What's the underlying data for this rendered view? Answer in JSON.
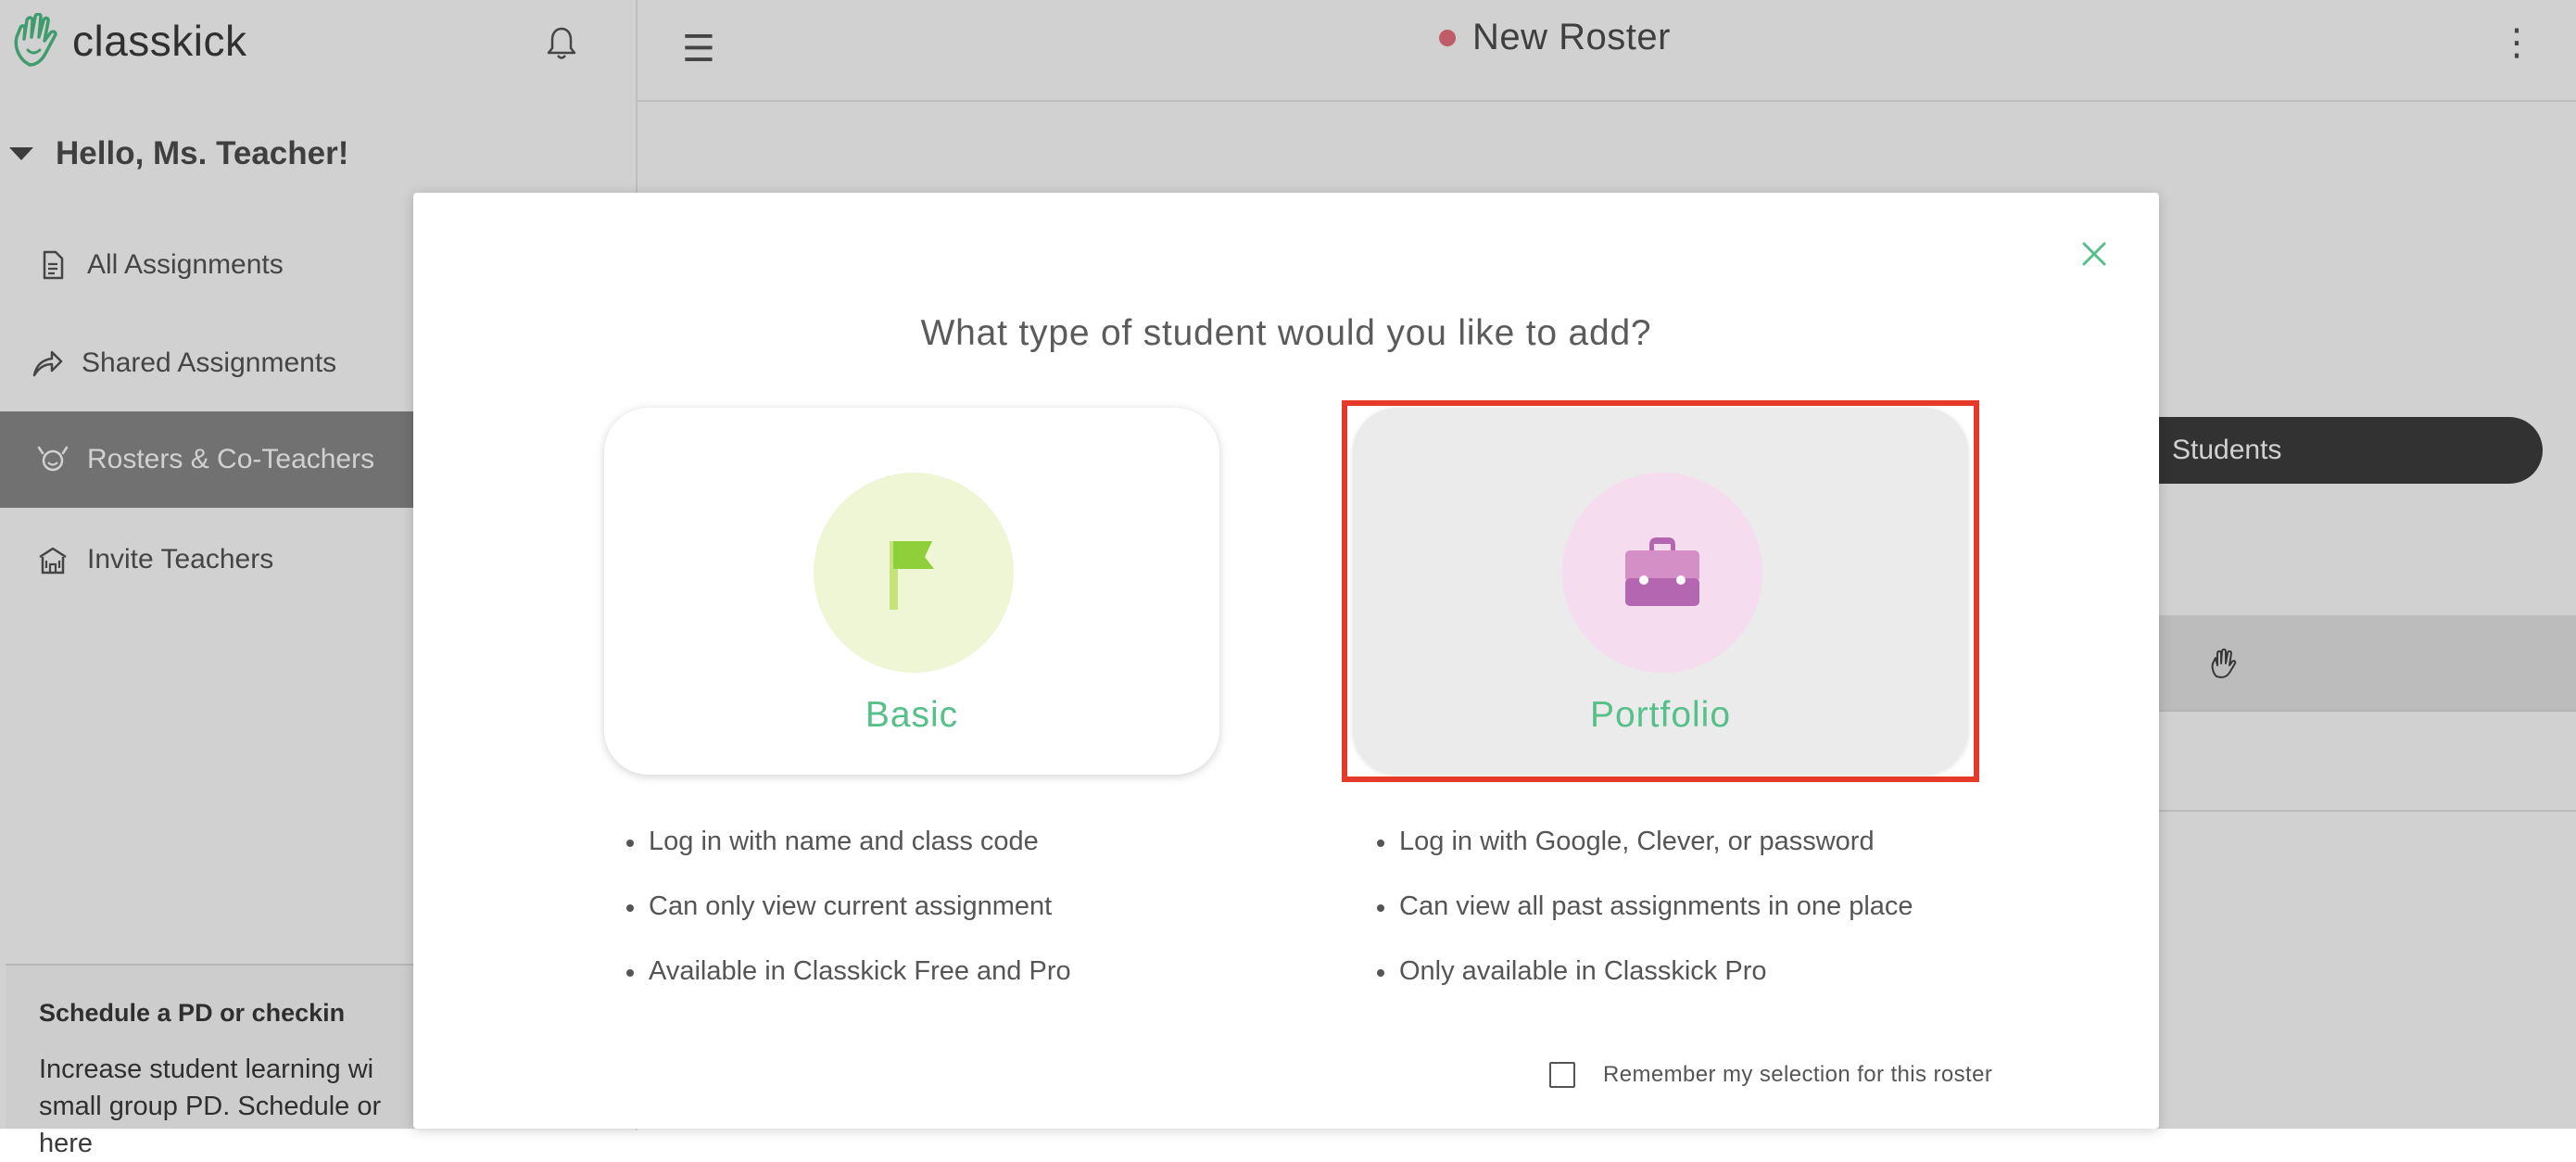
{
  "app": {
    "logo_text": "classkick"
  },
  "sidebar": {
    "greeting": "Hello, Ms. Teacher!",
    "items": [
      {
        "label": "All Assignments",
        "icon": "document-icon"
      },
      {
        "label": "Shared Assignments",
        "icon": "share-arrow-icon"
      },
      {
        "label": "Rosters & Co-Teachers",
        "icon": "roster-icon",
        "active": true
      },
      {
        "label": "Invite Teachers",
        "icon": "school-building-icon"
      }
    ],
    "pd_box": {
      "title": "Schedule a PD or checkin",
      "body": "Increase student learning wi small group PD. Schedule or here"
    }
  },
  "header": {
    "title": "New Roster",
    "status_color": "#e8717f"
  },
  "main": {
    "students_pill": "Students"
  },
  "modal": {
    "title": "What type of student would you like to add?",
    "options": [
      {
        "label": "Basic",
        "icon": "flag-icon",
        "circle_color": "#eff6d6",
        "features": [
          "Log in with name and class code",
          "Can only view current assignment",
          "Available in Classkick Free and Pro"
        ]
      },
      {
        "label": "Portfolio",
        "icon": "briefcase-icon",
        "circle_color": "#f5dcee",
        "highlighted": true,
        "features": [
          "Log in with Google, Clever, or password",
          "Can view all past assignments in one place",
          "Only available in Classkick Pro"
        ]
      }
    ],
    "remember_label": "Remember my selection for this roster",
    "remember_checked": false
  },
  "colors": {
    "accent_green": "#56c08a",
    "highlight_red": "#e53a2a"
  }
}
